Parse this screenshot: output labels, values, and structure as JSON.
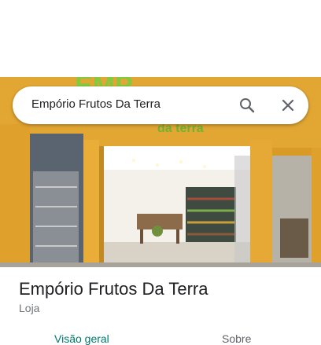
{
  "search": {
    "query": "Empório Frutos Da Terra",
    "search_icon": "search-icon",
    "close_icon": "close-icon"
  },
  "photo": {
    "sign_text": "EMP",
    "sign_subtext": "da terra",
    "colors": {
      "facade": "#e0a62e",
      "sign_green": "#7cc63a"
    }
  },
  "place": {
    "title": "Empório Frutos Da Terra",
    "category": "Loja"
  },
  "tabs": [
    {
      "label": "Visão geral",
      "active": true
    },
    {
      "label": "Sobre",
      "active": false
    }
  ],
  "colors": {
    "accent": "#00796b",
    "text": "#202124",
    "secondary": "#70757a"
  }
}
